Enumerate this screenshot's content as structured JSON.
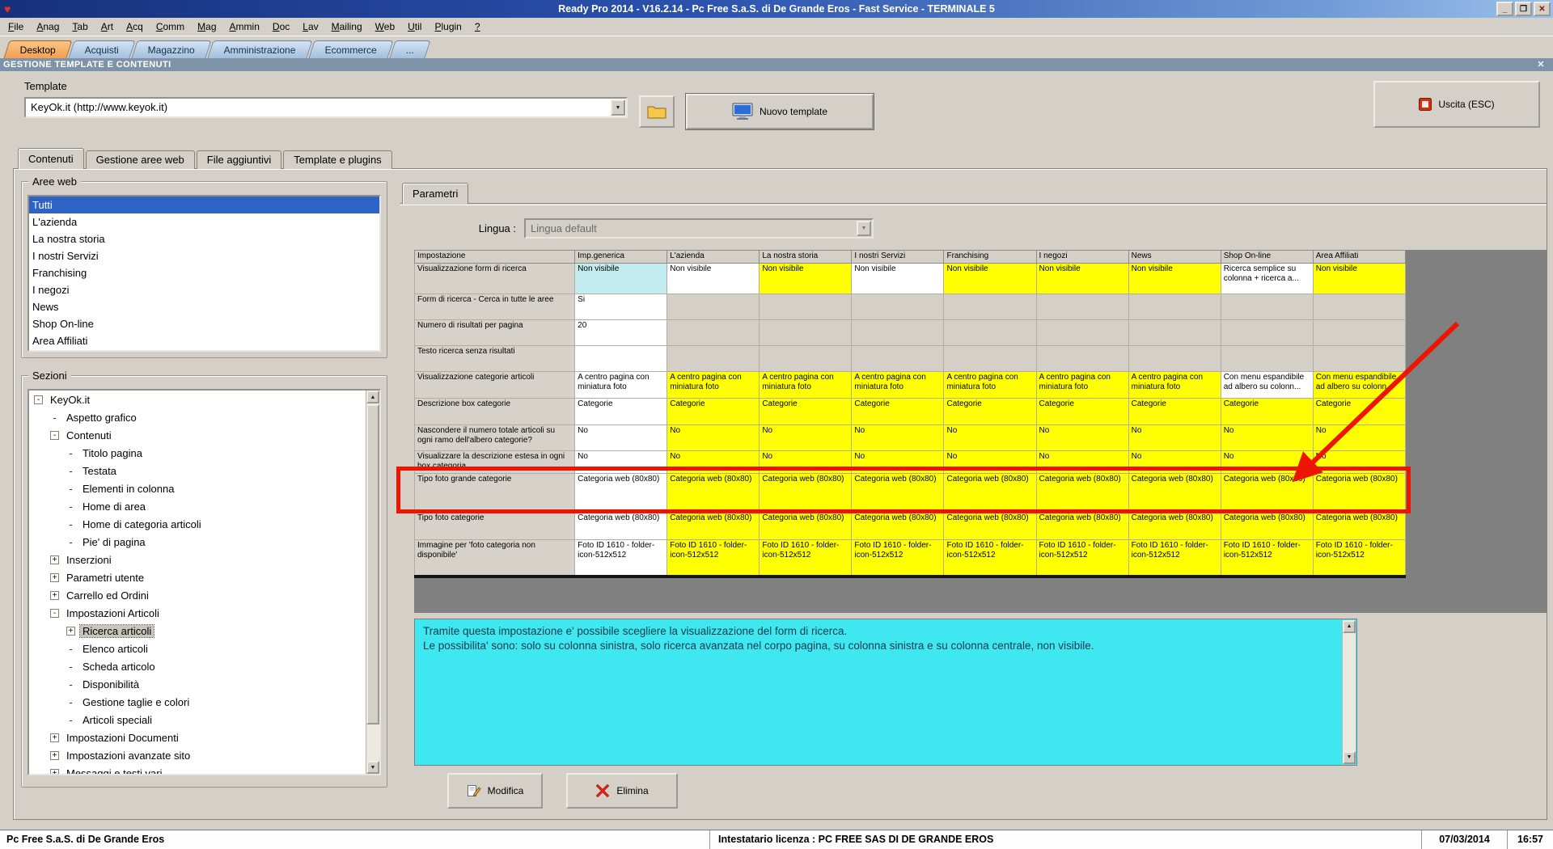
{
  "colors": {
    "highlight_yellow": "#ffff00",
    "annotation_red": "#ed1500",
    "info_cyan": "#3fe8f0",
    "selection_blue": "#2e62c4",
    "active_tab_orange": "#f2a054",
    "module_header_blue": "#7e93a7"
  },
  "icons": {
    "app_logo": "♥",
    "minimize": "_",
    "maximize": "❐",
    "close": "✕",
    "module_close": "✕",
    "dropdown_arrow": "▼",
    "scroll_up": "▲",
    "scroll_down": "▼",
    "tree_expand": "+",
    "tree_collapse": "-",
    "tree_leaf": "-"
  },
  "titlebar": {
    "title": "Ready Pro 2014 - V16.2.14 - Pc Free S.a.S. di De Grande Eros - Fast Service - TERMINALE 5"
  },
  "menubar": {
    "items": [
      "File",
      "Anag",
      "Tab",
      "Art",
      "Acq",
      "Comm",
      "Mag",
      "Ammin",
      "Doc",
      "Lav",
      "Mailing",
      "Web",
      "Util",
      "Plugin",
      "?"
    ]
  },
  "workspace_tabs": {
    "items": [
      {
        "label": "Desktop",
        "active": true
      },
      {
        "label": "Acquisti",
        "active": false
      },
      {
        "label": "Magazzino",
        "active": false
      },
      {
        "label": "Amministrazione",
        "active": false
      },
      {
        "label": "Ecommerce",
        "active": false
      },
      {
        "label": "...",
        "active": false
      }
    ]
  },
  "module_header": {
    "title": "GESTIONE TEMPLATE E CONTENUTI"
  },
  "template_section": {
    "label": "Template",
    "combo_value": "KeyOk.it (http://www.keyok.it)",
    "new_template_button": "Nuovo template",
    "exit_button": "Uscita (ESC)"
  },
  "content_tabs": {
    "items": [
      {
        "label": "Contenuti",
        "active": true
      },
      {
        "label": "Gestione aree web",
        "active": false
      },
      {
        "label": "File aggiuntivi",
        "active": false
      },
      {
        "label": "Template e plugins",
        "active": false
      }
    ]
  },
  "aree_web": {
    "label": "Aree web",
    "selected_index": 0,
    "items": [
      "Tutti",
      "L'azienda",
      "La nostra storia",
      "I nostri Servizi",
      "Franchising",
      "I negozi",
      "News",
      "Shop On-line",
      "Area Affiliati"
    ]
  },
  "sezioni": {
    "label": "Sezioni",
    "tree": [
      {
        "label": "KeyOk.it",
        "level": 0,
        "expander": "-"
      },
      {
        "label": "Aspetto grafico",
        "level": 1,
        "expander": "leaf"
      },
      {
        "label": "Contenuti",
        "level": 1,
        "expander": "-"
      },
      {
        "label": "Titolo pagina",
        "level": 2,
        "expander": "leaf"
      },
      {
        "label": "Testata",
        "level": 2,
        "expander": "leaf"
      },
      {
        "label": "Elementi in colonna",
        "level": 2,
        "expander": "leaf"
      },
      {
        "label": "Home di area",
        "level": 2,
        "expander": "leaf"
      },
      {
        "label": "Home di categoria articoli",
        "level": 2,
        "expander": "leaf"
      },
      {
        "label": "Pie' di pagina",
        "level": 2,
        "expander": "leaf"
      },
      {
        "label": "Inserzioni",
        "level": 1,
        "expander": "+"
      },
      {
        "label": "Parametri utente",
        "level": 1,
        "expander": "+"
      },
      {
        "label": "Carrello ed Ordini",
        "level": 1,
        "expander": "+"
      },
      {
        "label": "Impostazioni Articoli",
        "level": 1,
        "expander": "-"
      },
      {
        "label": "Ricerca articoli",
        "level": 2,
        "expander": "+",
        "selected": true
      },
      {
        "label": "Elenco articoli",
        "level": 2,
        "expander": "leaf"
      },
      {
        "label": "Scheda articolo",
        "level": 2,
        "expander": "leaf"
      },
      {
        "label": "Disponibilità",
        "level": 2,
        "expander": "leaf"
      },
      {
        "label": "Gestione taglie e colori",
        "level": 2,
        "expander": "leaf"
      },
      {
        "label": "Articoli speciali",
        "level": 2,
        "expander": "leaf"
      },
      {
        "label": "Impostazioni Documenti",
        "level": 1,
        "expander": "+"
      },
      {
        "label": "Impostazioni avanzate sito",
        "level": 1,
        "expander": "+"
      },
      {
        "label": "Messaggi e testi vari",
        "level": 1,
        "expander": "+"
      }
    ]
  },
  "parametri": {
    "tab_label": "Parametri",
    "lingua_label": "Lingua :",
    "lingua_value": "Lingua default"
  },
  "settings_table": {
    "columns": [
      "Impostazione",
      "Imp.generica",
      "L'azienda",
      "La nostra storia",
      "I nostri Servizi",
      "Franchising",
      "I negozi",
      "News",
      "Shop On-line",
      "Area Affiliati"
    ],
    "rows": [
      {
        "name": "Visualizzazione form di ricerca",
        "cells": [
          {
            "text": "Non visibile",
            "bg": "cyan"
          },
          {
            "text": "Non visibile",
            "bg": "white"
          },
          {
            "text": "Non visibile",
            "bg": "yellow"
          },
          {
            "text": "Non visibile",
            "bg": "white"
          },
          {
            "text": "Non visibile",
            "bg": "yellow"
          },
          {
            "text": "Non visibile",
            "bg": "yellow"
          },
          {
            "text": "Non visibile",
            "bg": "yellow"
          },
          {
            "text": "Ricerca semplice su colonna + ricerca a...",
            "bg": "white"
          },
          {
            "text": "Non visibile",
            "bg": "yellow"
          }
        ]
      },
      {
        "name": "Form di ricerca - Cerca in tutte le aree",
        "cells": [
          {
            "text": "Si",
            "bg": "white"
          },
          {
            "text": "",
            "bg": "gray"
          },
          {
            "text": "",
            "bg": "gray"
          },
          {
            "text": "",
            "bg": "gray"
          },
          {
            "text": "",
            "bg": "gray"
          },
          {
            "text": "",
            "bg": "gray"
          },
          {
            "text": "",
            "bg": "gray"
          },
          {
            "text": "",
            "bg": "gray"
          },
          {
            "text": "",
            "bg": "gray"
          }
        ]
      },
      {
        "name": "Numero di risultati per pagina",
        "cells": [
          {
            "text": "20",
            "bg": "white"
          },
          {
            "text": "",
            "bg": "gray"
          },
          {
            "text": "",
            "bg": "gray"
          },
          {
            "text": "",
            "bg": "gray"
          },
          {
            "text": "",
            "bg": "gray"
          },
          {
            "text": "",
            "bg": "gray"
          },
          {
            "text": "",
            "bg": "gray"
          },
          {
            "text": "",
            "bg": "gray"
          },
          {
            "text": "",
            "bg": "gray"
          }
        ]
      },
      {
        "name": "Testo ricerca senza risultati",
        "cells": [
          {
            "text": "",
            "bg": "white"
          },
          {
            "text": "",
            "bg": "gray"
          },
          {
            "text": "",
            "bg": "gray"
          },
          {
            "text": "",
            "bg": "gray"
          },
          {
            "text": "",
            "bg": "gray"
          },
          {
            "text": "",
            "bg": "gray"
          },
          {
            "text": "",
            "bg": "gray"
          },
          {
            "text": "",
            "bg": "gray"
          },
          {
            "text": "",
            "bg": "gray"
          }
        ]
      },
      {
        "name": "Visualizzazione categorie articoli",
        "cells": [
          {
            "text": "A centro pagina con miniatura foto",
            "bg": "white"
          },
          {
            "text": "A centro pagina con miniatura foto",
            "bg": "yellow"
          },
          {
            "text": "A centro pagina con miniatura foto",
            "bg": "yellow"
          },
          {
            "text": "A centro pagina con miniatura foto",
            "bg": "yellow"
          },
          {
            "text": "A centro pagina con miniatura foto",
            "bg": "yellow"
          },
          {
            "text": "A centro pagina con miniatura foto",
            "bg": "yellow"
          },
          {
            "text": "A centro pagina con miniatura foto",
            "bg": "yellow"
          },
          {
            "text": "Con menu espandibile ad albero su colonn...",
            "bg": "white"
          },
          {
            "text": "Con menu espandibile ad albero su colonn...",
            "bg": "yellow"
          }
        ]
      },
      {
        "name": "Descrizione box categorie",
        "cells": [
          {
            "text": "Categorie",
            "bg": "white"
          },
          {
            "text": "Categorie",
            "bg": "yellow"
          },
          {
            "text": "Categorie",
            "bg": "yellow"
          },
          {
            "text": "Categorie",
            "bg": "yellow"
          },
          {
            "text": "Categorie",
            "bg": "yellow"
          },
          {
            "text": "Categorie",
            "bg": "yellow"
          },
          {
            "text": "Categorie",
            "bg": "yellow"
          },
          {
            "text": "Categorie",
            "bg": "yellow"
          },
          {
            "text": "Categorie",
            "bg": "yellow"
          }
        ]
      },
      {
        "name": "Nascondere il numero totale articoli su ogni ramo dell'albero categorie?",
        "cells": [
          {
            "text": "No",
            "bg": "white"
          },
          {
            "text": "No",
            "bg": "yellow"
          },
          {
            "text": "No",
            "bg": "yellow"
          },
          {
            "text": "No",
            "bg": "yellow"
          },
          {
            "text": "No",
            "bg": "yellow"
          },
          {
            "text": "No",
            "bg": "yellow"
          },
          {
            "text": "No",
            "bg": "yellow"
          },
          {
            "text": "No",
            "bg": "yellow"
          },
          {
            "text": "No",
            "bg": "yellow"
          }
        ]
      },
      {
        "name": "Visualizzare la descrizione estesa in ogni box categoria",
        "cells": [
          {
            "text": "No",
            "bg": "white"
          },
          {
            "text": "No",
            "bg": "yellow"
          },
          {
            "text": "No",
            "bg": "yellow"
          },
          {
            "text": "No",
            "bg": "yellow"
          },
          {
            "text": "No",
            "bg": "yellow"
          },
          {
            "text": "No",
            "bg": "yellow"
          },
          {
            "text": "No",
            "bg": "yellow"
          },
          {
            "text": "No",
            "bg": "yellow"
          },
          {
            "text": "No",
            "bg": "yellow"
          }
        ]
      },
      {
        "name": "Tipo foto grande categorie",
        "cells": [
          {
            "text": "Categoria web (80x80)",
            "bg": "white"
          },
          {
            "text": "Categoria web (80x80)",
            "bg": "yellow"
          },
          {
            "text": "Categoria web (80x80)",
            "bg": "yellow"
          },
          {
            "text": "Categoria web (80x80)",
            "bg": "yellow"
          },
          {
            "text": "Categoria web (80x80)",
            "bg": "yellow"
          },
          {
            "text": "Categoria web (80x80)",
            "bg": "yellow"
          },
          {
            "text": "Categoria web (80x80)",
            "bg": "yellow"
          },
          {
            "text": "Categoria web (80x80)",
            "bg": "yellow"
          },
          {
            "text": "Categoria web (80x80)",
            "bg": "yellow"
          }
        ]
      },
      {
        "name": "Tipo foto categorie",
        "cells": [
          {
            "text": "Categoria web (80x80)",
            "bg": "white"
          },
          {
            "text": "Categoria web (80x80)",
            "bg": "yellow"
          },
          {
            "text": "Categoria web (80x80)",
            "bg": "yellow"
          },
          {
            "text": "Categoria web (80x80)",
            "bg": "yellow"
          },
          {
            "text": "Categoria web (80x80)",
            "bg": "yellow"
          },
          {
            "text": "Categoria web (80x80)",
            "bg": "yellow"
          },
          {
            "text": "Categoria web (80x80)",
            "bg": "yellow"
          },
          {
            "text": "Categoria web (80x80)",
            "bg": "yellow"
          },
          {
            "text": "Categoria web (80x80)",
            "bg": "yellow"
          }
        ]
      },
      {
        "name": "Immagine per 'foto categoria non disponibile'",
        "cells": [
          {
            "text": "Foto ID 1610 - folder-icon-512x512",
            "bg": "white"
          },
          {
            "text": "Foto ID 1610 - folder-icon-512x512",
            "bg": "yellow"
          },
          {
            "text": "Foto ID 1610 - folder-icon-512x512",
            "bg": "yellow"
          },
          {
            "text": "Foto ID 1610 - folder-icon-512x512",
            "bg": "yellow"
          },
          {
            "text": "Foto ID 1610 - folder-icon-512x512",
            "bg": "yellow"
          },
          {
            "text": "Foto ID 1610 - folder-icon-512x512",
            "bg": "yellow"
          },
          {
            "text": "Foto ID 1610 - folder-icon-512x512",
            "bg": "yellow"
          },
          {
            "text": "Foto ID 1610 - folder-icon-512x512",
            "bg": "yellow"
          },
          {
            "text": "Foto ID 1610 - folder-icon-512x512",
            "bg": "yellow"
          }
        ]
      }
    ]
  },
  "info_box": {
    "line1": "Tramite questa impostazione e' possibile scegliere la visualizzazione del form di ricerca.",
    "line2": "Le possibilita' sono: solo su colonna sinistra, solo ricerca avanzata nel corpo pagina, su colonna sinistra e su colonna centrale, non visibile."
  },
  "action_buttons": {
    "modifica": "Modifica",
    "elimina": "Elimina"
  },
  "statusbar": {
    "company": "Pc Free S.a.S. di De Grande Eros",
    "license": "Intestatario licenza : PC FREE SAS DI DE GRANDE EROS",
    "date": "07/03/2014",
    "time": "16:57"
  }
}
